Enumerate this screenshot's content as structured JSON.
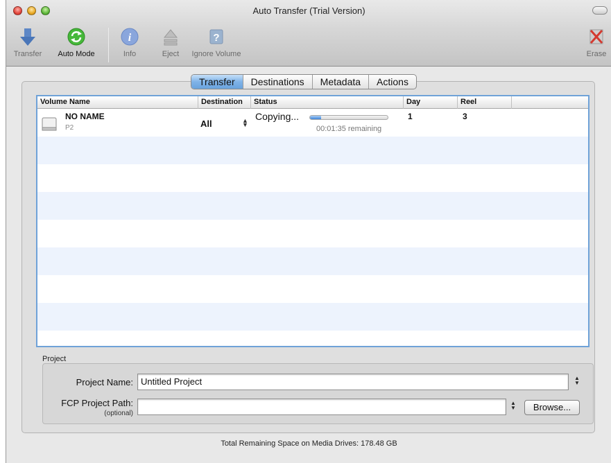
{
  "window": {
    "title": "Auto Transfer (Trial Version)"
  },
  "toolbar": {
    "transfer": "Transfer",
    "auto_mode": "Auto Mode",
    "info": "Info",
    "eject": "Eject",
    "ignore_volume": "Ignore Volume",
    "erase": "Erase"
  },
  "tabs": [
    "Transfer",
    "Destinations",
    "Metadata",
    "Actions"
  ],
  "selected_tab": "Transfer",
  "table": {
    "columns": [
      "Volume Name",
      "Destination",
      "Status",
      "Day",
      "Reel"
    ],
    "rows": [
      {
        "volume_name": "NO NAME",
        "volume_type": "P2",
        "destination": "All",
        "status": "Copying...",
        "remaining": "00:01:35 remaining",
        "progress_fraction": 0.14,
        "day": "1",
        "reel": "3"
      }
    ]
  },
  "project": {
    "section_label": "Project",
    "name_label": "Project Name:",
    "name_value": "Untitled Project",
    "path_label": "FCP Project Path:",
    "path_optional": "(optional)",
    "path_value": "",
    "browse_label": "Browse..."
  },
  "footer": "Total Remaining Space on Media Drives: 178.48 GB",
  "colors": {
    "accent": "#3f84d8",
    "selected_tab": "#7fb3e8",
    "row_alt": "#edf3fd"
  }
}
